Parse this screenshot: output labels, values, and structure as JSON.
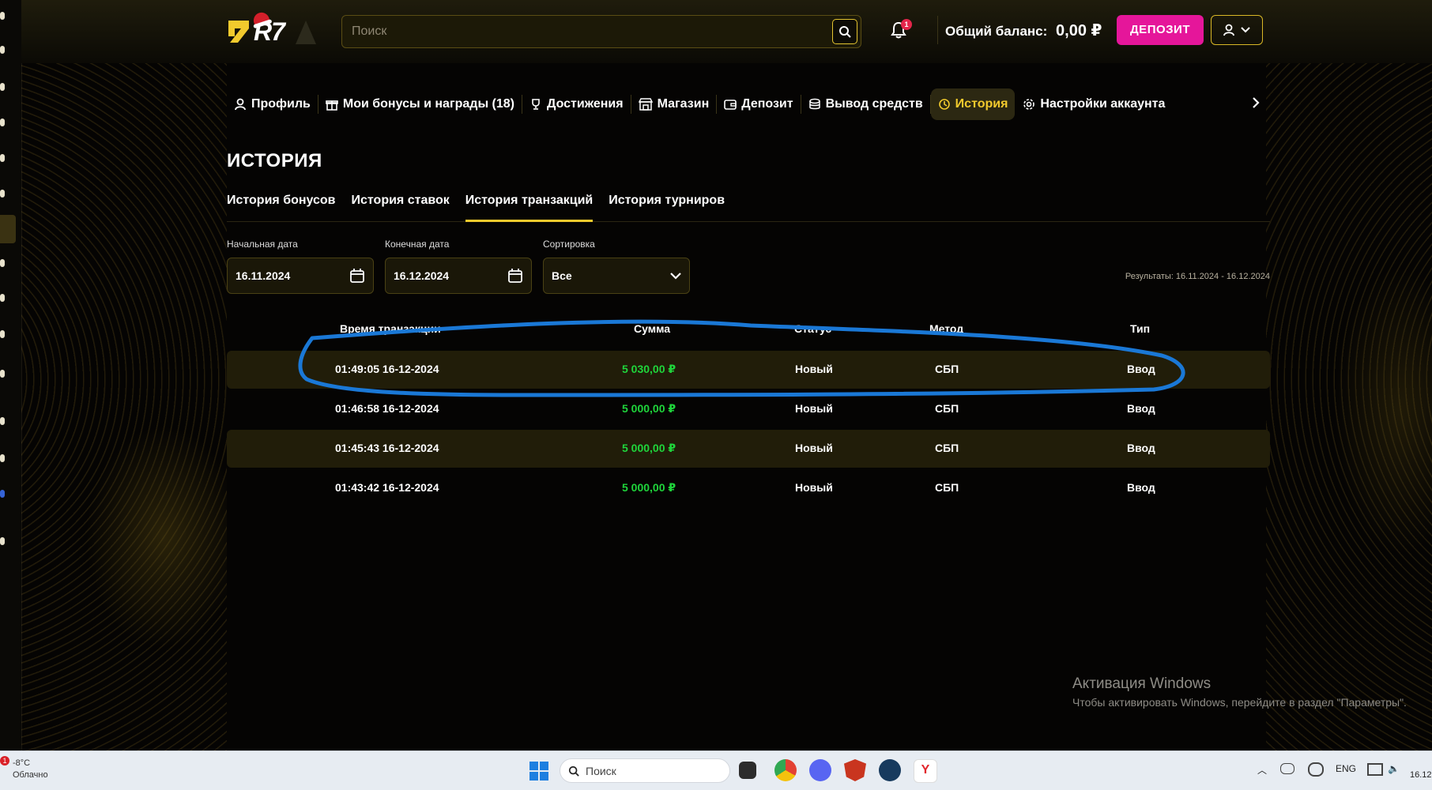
{
  "header": {
    "logo_text": "R7",
    "search_placeholder": "Поиск",
    "notification_count": "1",
    "balance_label": "Общий баланс:",
    "balance_value": "0,00 ₽",
    "deposit_label": "ДЕПОЗИТ"
  },
  "nav": [
    {
      "label": "Профиль",
      "icon": "user-icon"
    },
    {
      "label": "Мои бонусы и награды (18)",
      "icon": "gift-icon"
    },
    {
      "label": "Достижения",
      "icon": "trophy-icon"
    },
    {
      "label": "Магазин",
      "icon": "shop-icon"
    },
    {
      "label": "Депозит",
      "icon": "wallet-icon"
    },
    {
      "label": "Вывод средств",
      "icon": "coins-icon"
    },
    {
      "label": "История",
      "icon": "history-icon",
      "active": true
    },
    {
      "label": "Настройки аккаунта",
      "icon": "gear-icon"
    }
  ],
  "page": {
    "title": "ИСТОРИЯ",
    "tabs": [
      "История бонусов",
      "История ставок",
      "История транзакций",
      "История турниров"
    ],
    "active_tab": "История транзакций"
  },
  "filters": {
    "start_label": "Начальная дата",
    "start_value": "16.11.2024",
    "end_label": "Конечная дата",
    "end_value": "16.12.2024",
    "sort_label": "Сортировка",
    "sort_value": "Все",
    "results": "Результаты: 16.11.2024 - 16.12.2024"
  },
  "table": {
    "columns": [
      "Время транзакции",
      "Сумма",
      "Статус",
      "Метод",
      "Тип"
    ],
    "rows": [
      {
        "time": "01:49:05 16-12-2024",
        "sum": "5 030,00 ₽",
        "status": "Новый",
        "method": "СБП",
        "type": "Ввод"
      },
      {
        "time": "01:46:58 16-12-2024",
        "sum": "5 000,00 ₽",
        "status": "Новый",
        "method": "СБП",
        "type": "Ввод"
      },
      {
        "time": "01:45:43 16-12-2024",
        "sum": "5 000,00 ₽",
        "status": "Новый",
        "method": "СБП",
        "type": "Ввод"
      },
      {
        "time": "01:43:42 16-12-2024",
        "sum": "5 000,00 ₽",
        "status": "Новый",
        "method": "СБП",
        "type": "Ввод"
      }
    ]
  },
  "windows": {
    "activation_title": "Активация Windows",
    "activation_text": "Чтобы активировать Windows, перейдите в раздел \"Параметры\".",
    "weather_temp": "-8°C",
    "weather_cond": "Облачно",
    "weather_badge": "1",
    "taskbar_search": "Поиск",
    "lang": "ENG",
    "clock": "16.12"
  },
  "colors": {
    "accent_yellow": "#f2ca2d",
    "deposit_pink": "#e5169a",
    "sum_green": "#1fd53b",
    "annotation_blue": "#1a78d6"
  }
}
